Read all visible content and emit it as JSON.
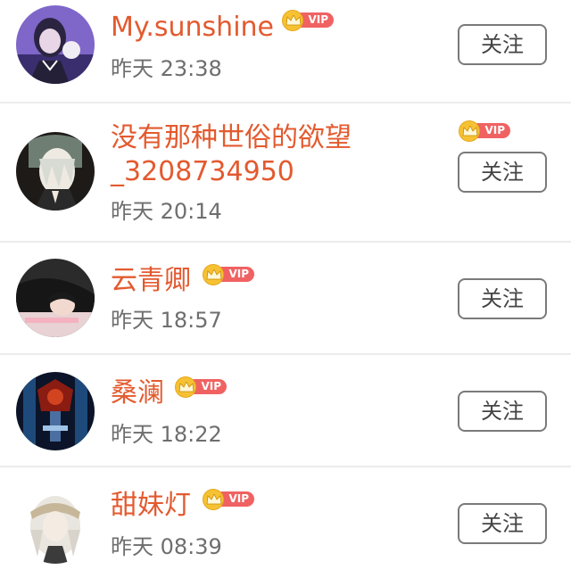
{
  "items": [
    {
      "name": "My.sunshine",
      "time": "昨天 23:38",
      "vip_label": "VIP",
      "button": "关注",
      "avatar": "avatar-girl-purple"
    },
    {
      "name_line1": "没有那种世俗的欲望",
      "name_line2": "_3208734950",
      "time": "昨天 20:14",
      "vip_label": "VIP",
      "button": "关注",
      "avatar": "avatar-anime-praying"
    },
    {
      "name": "云青卿",
      "time": "昨天 18:57",
      "vip_label": "VIP",
      "button": "关注",
      "avatar": "avatar-sleeping-girl"
    },
    {
      "name": "桑澜",
      "time": "昨天 18:22",
      "vip_label": "VIP",
      "button": "关注",
      "avatar": "avatar-dark-red-scene"
    },
    {
      "name": "甜妹灯",
      "time": "昨天 08:39",
      "vip_label": "VIP",
      "button": "关注",
      "avatar": "avatar-anime-white-hair"
    }
  ],
  "colors": {
    "name": "#e35a2f",
    "time": "#6e6e6e",
    "vip": "#f06262",
    "crown": "#f6c233"
  }
}
